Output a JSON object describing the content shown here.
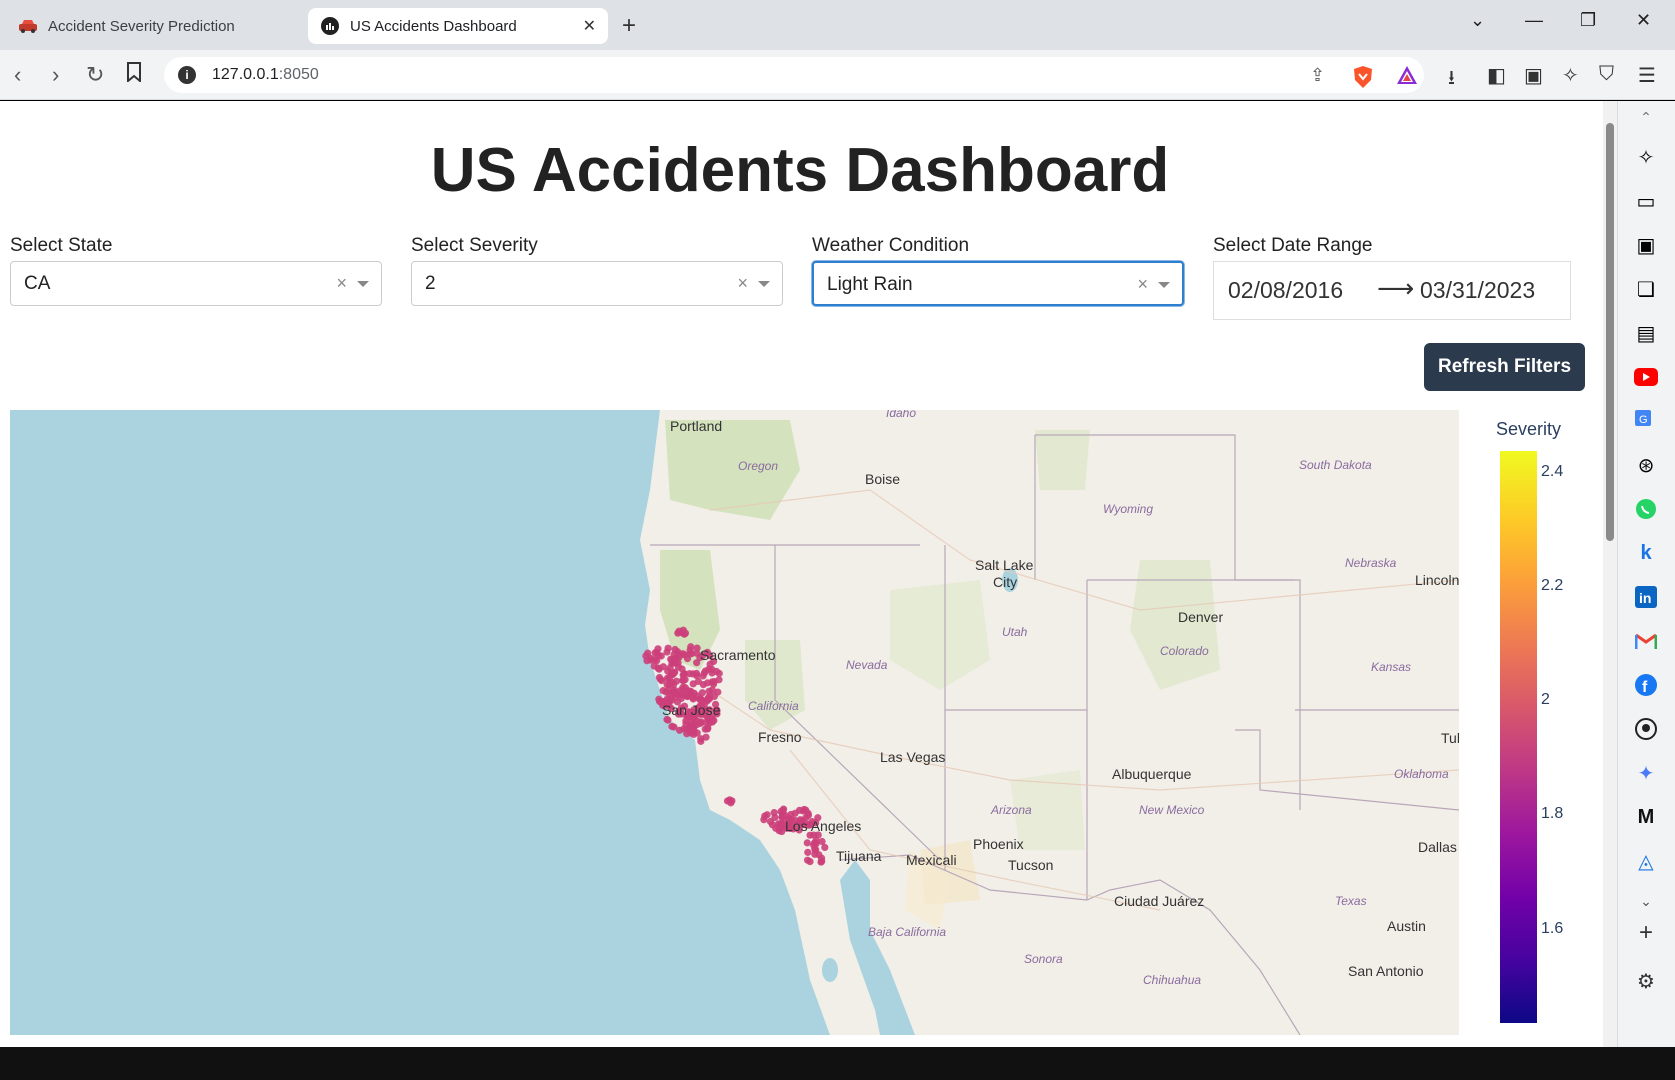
{
  "browser": {
    "tabs": [
      {
        "title": "Accident Severity Prediction",
        "active": false,
        "icon": "car-icon"
      },
      {
        "title": "US Accidents Dashboard",
        "active": true,
        "icon": "dash-icon"
      }
    ],
    "url_host": "127.0.0.1",
    "url_port": ":8050"
  },
  "page": {
    "title": "US Accidents Dashboard"
  },
  "filters": {
    "state": {
      "label": "Select State",
      "value": "CA"
    },
    "severity": {
      "label": "Select Severity",
      "value": "2"
    },
    "weather": {
      "label": "Weather Condition",
      "value": "Light Rain"
    },
    "date_range": {
      "label": "Select Date Range",
      "start": "02/08/2016",
      "end": "03/31/2023"
    }
  },
  "refresh_label": "Refresh Filters",
  "map": {
    "cities": [
      {
        "name": "Portland"
      },
      {
        "name": "Boise"
      },
      {
        "name": "Salt Lake"
      },
      {
        "name": "City"
      },
      {
        "name": "Denver"
      },
      {
        "name": "Lincoln"
      },
      {
        "name": "Sacramento"
      },
      {
        "name": "San Jose"
      },
      {
        "name": "Fresno"
      },
      {
        "name": "Las Vegas"
      },
      {
        "name": "Albuquerque"
      },
      {
        "name": "Los Angeles"
      },
      {
        "name": "Tijuana"
      },
      {
        "name": "Mexicali"
      },
      {
        "name": "Phoenix"
      },
      {
        "name": "Tucson"
      },
      {
        "name": "Ciudad Juárez"
      },
      {
        "name": "Dallas"
      },
      {
        "name": "Austin"
      },
      {
        "name": "San Antonio"
      },
      {
        "name": "Tul"
      }
    ],
    "regions": [
      {
        "name": "Idaho"
      },
      {
        "name": "Oregon"
      },
      {
        "name": "South Dakota"
      },
      {
        "name": "Wyoming"
      },
      {
        "name": "Nebraska"
      },
      {
        "name": "Utah"
      },
      {
        "name": "Colorado"
      },
      {
        "name": "Nevada"
      },
      {
        "name": "Kansas"
      },
      {
        "name": "California"
      },
      {
        "name": "Oklahoma"
      },
      {
        "name": "Arizona"
      },
      {
        "name": "New Mexico"
      },
      {
        "name": "Texas"
      },
      {
        "name": "Baja California"
      },
      {
        "name": "Sonora"
      },
      {
        "name": "Chihuahua"
      }
    ],
    "marker_color": "#cc3f7a"
  },
  "colorbar": {
    "title": "Severity",
    "ticks": [
      "2.4",
      "2.2",
      "2",
      "1.8",
      "1.6"
    ]
  },
  "sidebar_icons": [
    "leo-icon",
    "video-icon",
    "wallet-icon",
    "bookmarks-icon",
    "reading-list-icon",
    "youtube-icon",
    "translate-icon",
    "chatgpt-icon",
    "whatsapp-icon",
    "k-icon",
    "linkedin-icon",
    "gmail-icon",
    "facebook-icon",
    "github-icon",
    "gemini-icon",
    "medium-icon",
    "app-icon"
  ]
}
